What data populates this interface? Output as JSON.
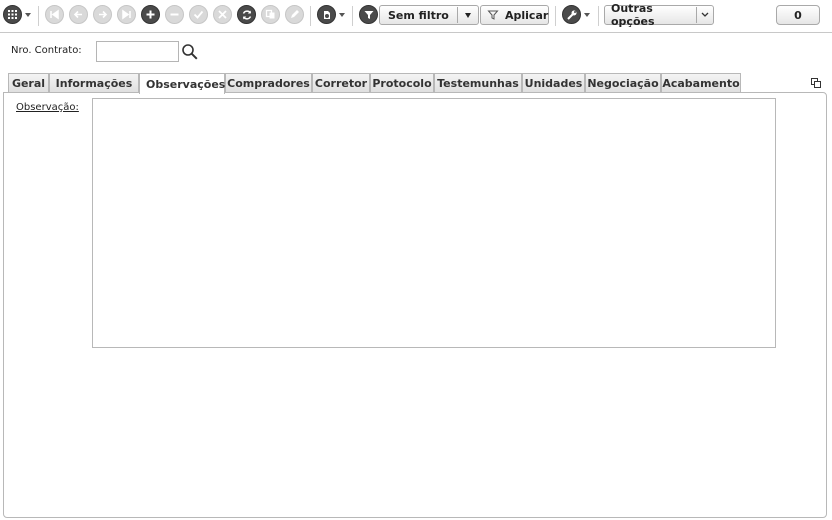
{
  "toolbar": {
    "filter_label": "Sem filtro",
    "apply_label": "Aplicar",
    "other_options_label": "Outras opções",
    "counter_value": "0"
  },
  "form": {
    "contract_label": "Nro. Contrato:",
    "contract_value": ""
  },
  "tabs": [
    {
      "label": "Geral"
    },
    {
      "label": "Informações"
    },
    {
      "label": "Observações",
      "active": true
    },
    {
      "label": "Compradores"
    },
    {
      "label": "Corretor"
    },
    {
      "label": "Protocolo"
    },
    {
      "label": "Testemunhas"
    },
    {
      "label": "Unidades"
    },
    {
      "label": "Negociação"
    },
    {
      "label": "Acabamento"
    }
  ],
  "observacao": {
    "label": "Observação:",
    "value": ""
  },
  "icons": {
    "grid_menu": "grid-icon",
    "first": "first-record-icon",
    "previous": "previous-record-icon",
    "next": "next-record-icon",
    "last": "last-record-icon",
    "add": "add-icon",
    "remove": "remove-icon",
    "confirm": "check-icon",
    "cancel": "cancel-icon",
    "refresh": "refresh-icon",
    "copy": "copy-icon",
    "edit": "edit-icon",
    "attach": "attachment-icon",
    "filter": "filter-icon",
    "tools": "wrench-icon",
    "search": "search-icon",
    "detach": "popout-icon"
  }
}
